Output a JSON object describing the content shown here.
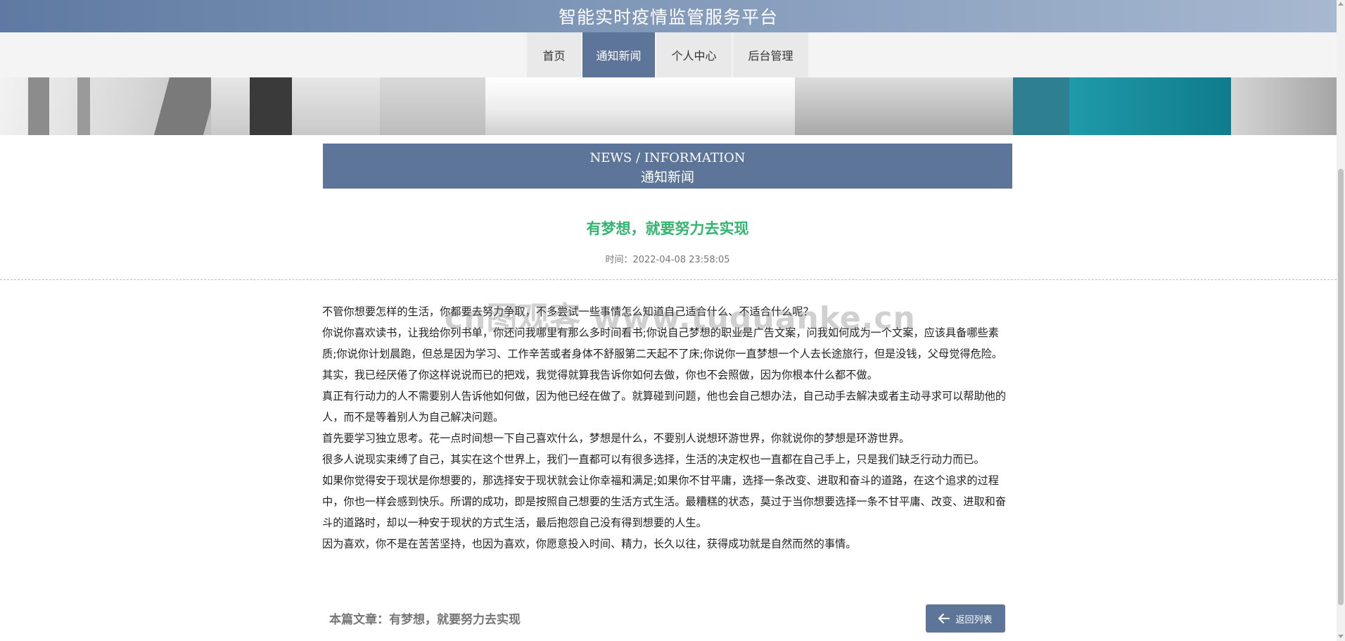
{
  "site": {
    "title": "智能实时疫情监管服务平台"
  },
  "nav": {
    "items": [
      {
        "label": "首页",
        "active": false
      },
      {
        "label": "通知新闻",
        "active": true
      },
      {
        "label": "个人中心",
        "active": false
      },
      {
        "label": "后台管理",
        "active": false
      }
    ]
  },
  "section": {
    "en": "NEWS / INFORMATION",
    "cn": "通知新闻"
  },
  "article": {
    "title": "有梦想，就要努力去实现",
    "meta": "时间：2022-04-08 23:58:05",
    "paragraphs": [
      "不管你想要怎样的生活，你都要去努力争取，不多尝试一些事情怎么知道自己适合什么、不适合什么呢？",
      "你说你喜欢读书，让我给你列书单，你还问我哪里有那么多时间看书;你说自己梦想的职业是广告文案，问我如何成为一个文案，应该具备哪些素质;你说你计划晨跑，但总是因为学习、工作辛苦或者身体不舒服第二天起不了床;你说你一直梦想一个人去长途旅行，但是没钱，父母觉得危险。其实，我已经厌倦了你这样说说而已的把戏，我觉得就算我告诉你如何去做，你也不会照做，因为你根本什么都不做。",
      "真正有行动力的人不需要别人告诉他如何做，因为他已经在做了。就算碰到问题，他也会自己想办法，自己动手去解决或者主动寻求可以帮助他的人，而不是等着别人为自己解决问题。",
      "首先要学习独立思考。花一点时间想一下自己喜欢什么，梦想是什么，不要别人说想环游世界，你就说你的梦想是环游世界。",
      "很多人说现实束缚了自己，其实在这个世界上，我们一直都可以有很多选择，生活的决定权也一直都在自己手上，只是我们缺乏行动力而已。",
      "如果你觉得安于现状是你想要的，那选择安于现状就会让你幸福和满足;如果你不甘平庸，选择一条改变、进取和奋斗的道路，在这个追求的过程中，你也一样会感到快乐。所谓的成功，即是按照自己想要的生活方式生活。最糟糕的状态，莫过于当你想要选择一条不甘平庸、改变、进取和奋斗的道路时，却以一种安于现状的方式生活，最后抱怨自己没有得到想要的人生。",
      "因为喜欢，你不是在苦苦坚持，也因为喜欢，你愿意投入时间、精力，长久以往，获得成功就是自然而然的事情。"
    ],
    "footer_label": "本篇文章：有梦想，就要努力去实现",
    "back_label": "返回列表"
  },
  "watermark": "cn图观客 www.tuguanke.cn",
  "colors": {
    "primary": "#5c7599",
    "title_green": "#33b570"
  }
}
